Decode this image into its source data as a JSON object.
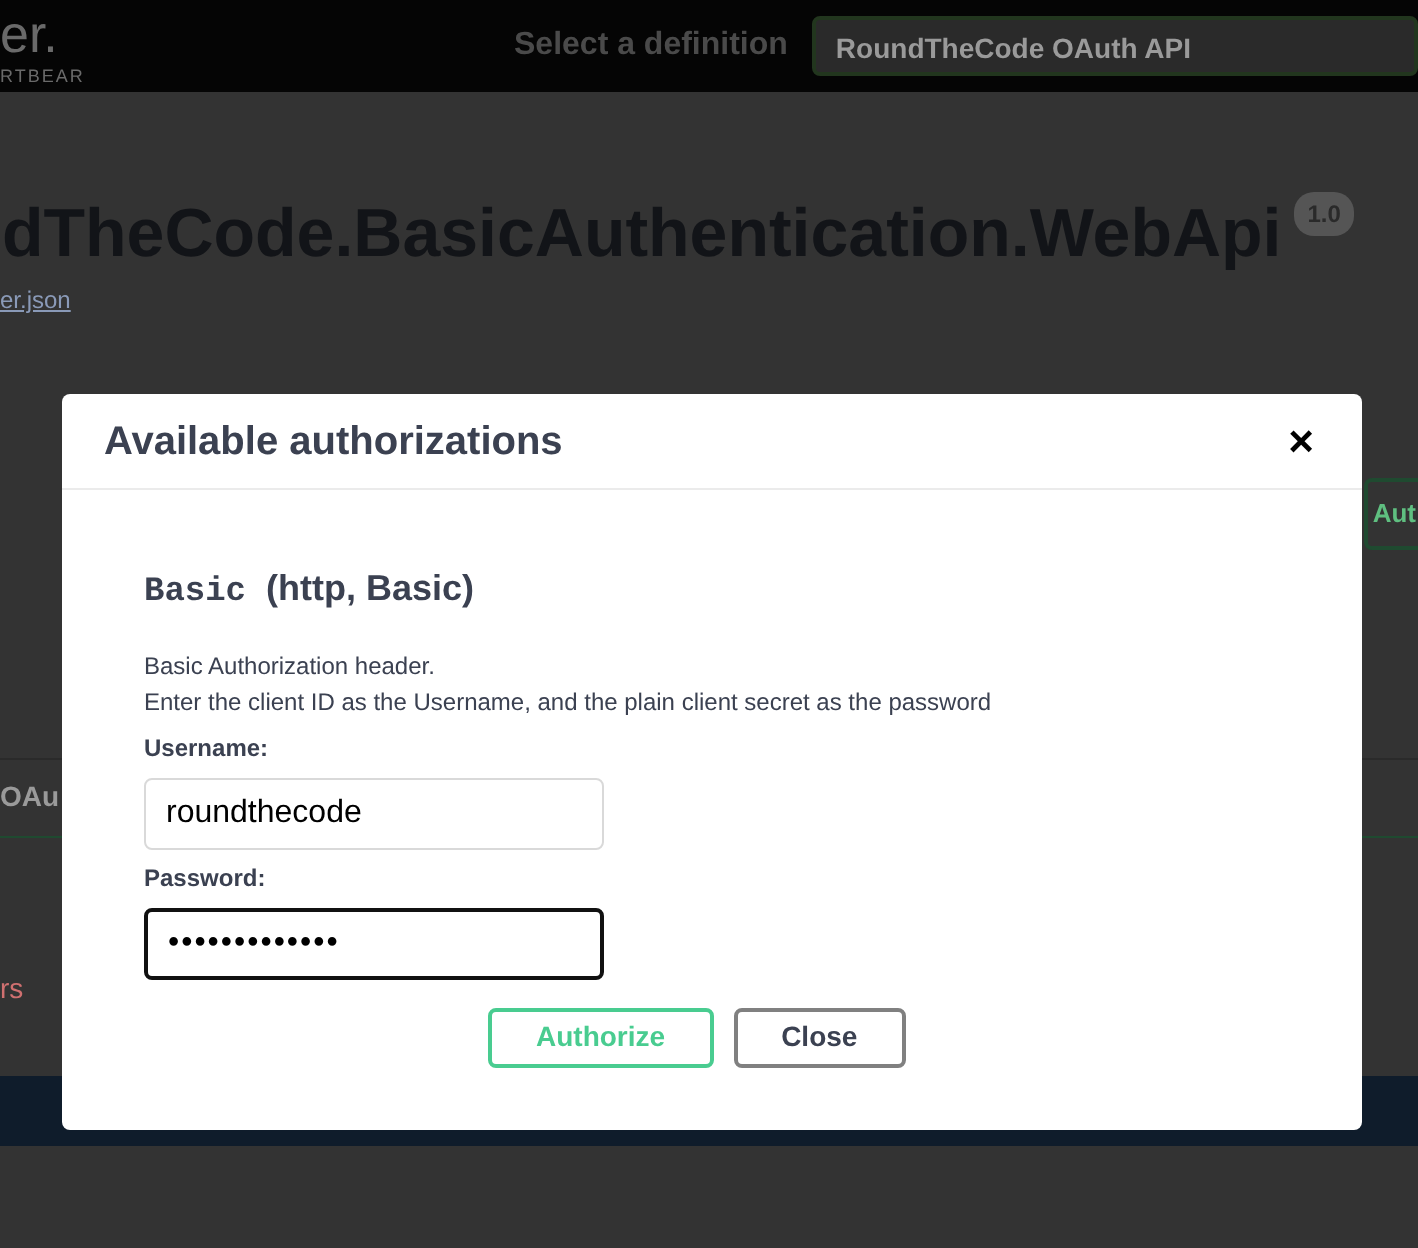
{
  "topbar": {
    "logo_text": "er.",
    "logo_subtext": "RTBEAR",
    "definition_label": "Select a definition",
    "definition_value": "RoundTheCode OAuth API"
  },
  "info": {
    "title": "dTheCode.BasicAuthentication.WebApi",
    "version": "1.0",
    "link": "er.json"
  },
  "behind": {
    "authorize_fragment": "Aut",
    "tag_fragment": "OAu",
    "text_fragment": "rs"
  },
  "dialog": {
    "title": "Available authorizations",
    "close": "×",
    "scheme": {
      "name": "Basic",
      "type": "(http, Basic)"
    },
    "description": [
      "Basic Authorization header.",
      "Enter the client ID as the Username, and the plain client secret as the password"
    ],
    "fields": [
      {
        "label": "Username:",
        "value": "roundthecode",
        "kind": "text",
        "focused": false
      },
      {
        "label": "Password:",
        "value": "•••••••••••••",
        "kind": "password",
        "focused": true
      }
    ],
    "buttons": [
      {
        "label": "Authorize",
        "kind": "authorize"
      },
      {
        "label": "Close",
        "kind": "close"
      }
    ]
  }
}
